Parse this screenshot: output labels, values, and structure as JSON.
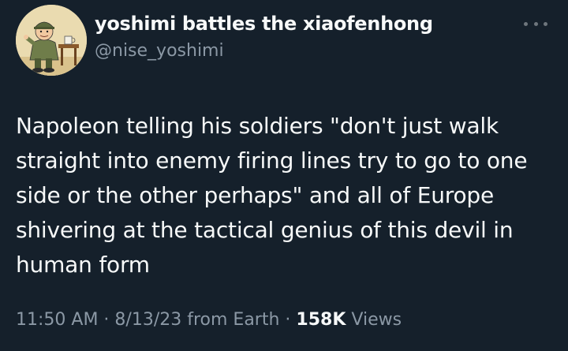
{
  "tweet": {
    "display_name": "yoshimi battles the xiaofenhong",
    "handle": "@nise_yoshimi",
    "text": "Napoleon telling his soldiers \"don't just walk straight into enemy firing lines try to go to one side or the other perhaps\" and all of Europe shivering at the tactical genius of this devil in human form",
    "time": "11:50 AM",
    "separator": " · ",
    "date": "8/13/23",
    "source": "from Earth",
    "views_count": "158K",
    "views_label": "Views"
  },
  "icons": {
    "more": "more-options-icon",
    "avatar": "cartoon-man-with-mug"
  },
  "colors": {
    "background": "#15202b",
    "text_primary": "#f7f9f9",
    "text_secondary": "#8b98a5"
  }
}
